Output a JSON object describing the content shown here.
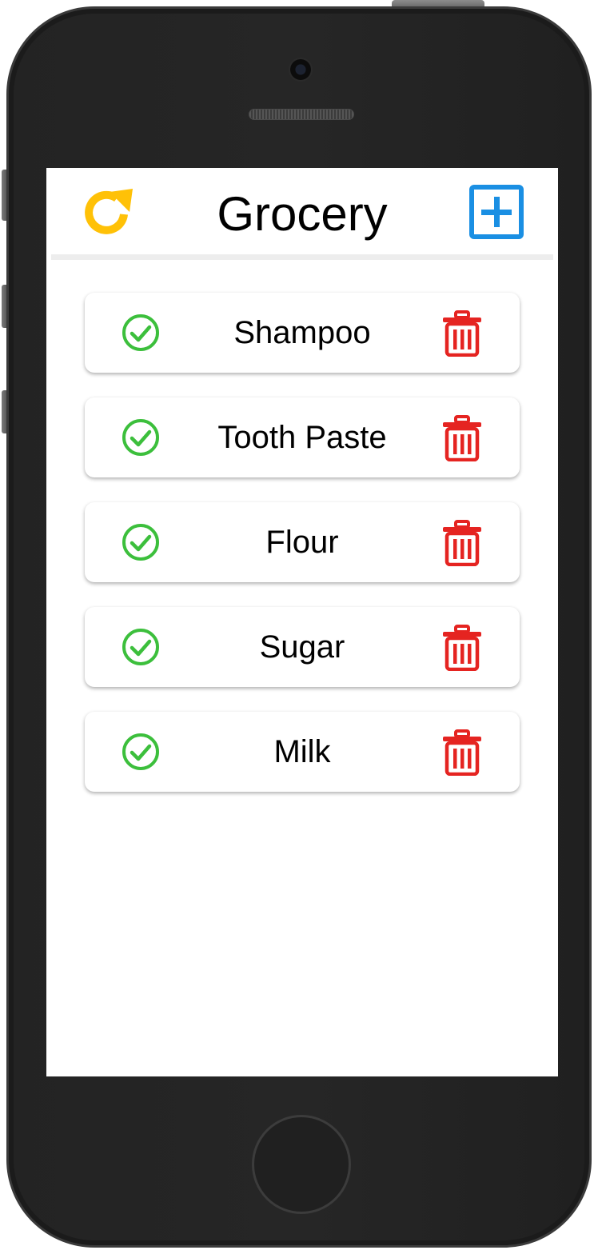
{
  "header": {
    "title": "Grocery",
    "refresh_icon": "refresh-icon",
    "add_icon": "add-box-icon"
  },
  "colors": {
    "refresh": "#ffc107",
    "add": "#1a8fe3",
    "check": "#3cbf3c",
    "delete": "#e52421"
  },
  "items": [
    {
      "label": "Shampoo"
    },
    {
      "label": "Tooth Paste"
    },
    {
      "label": "Flour"
    },
    {
      "label": "Sugar"
    },
    {
      "label": "Milk"
    }
  ],
  "item_icons": {
    "check": "check-circle-icon",
    "delete": "trash-icon"
  }
}
